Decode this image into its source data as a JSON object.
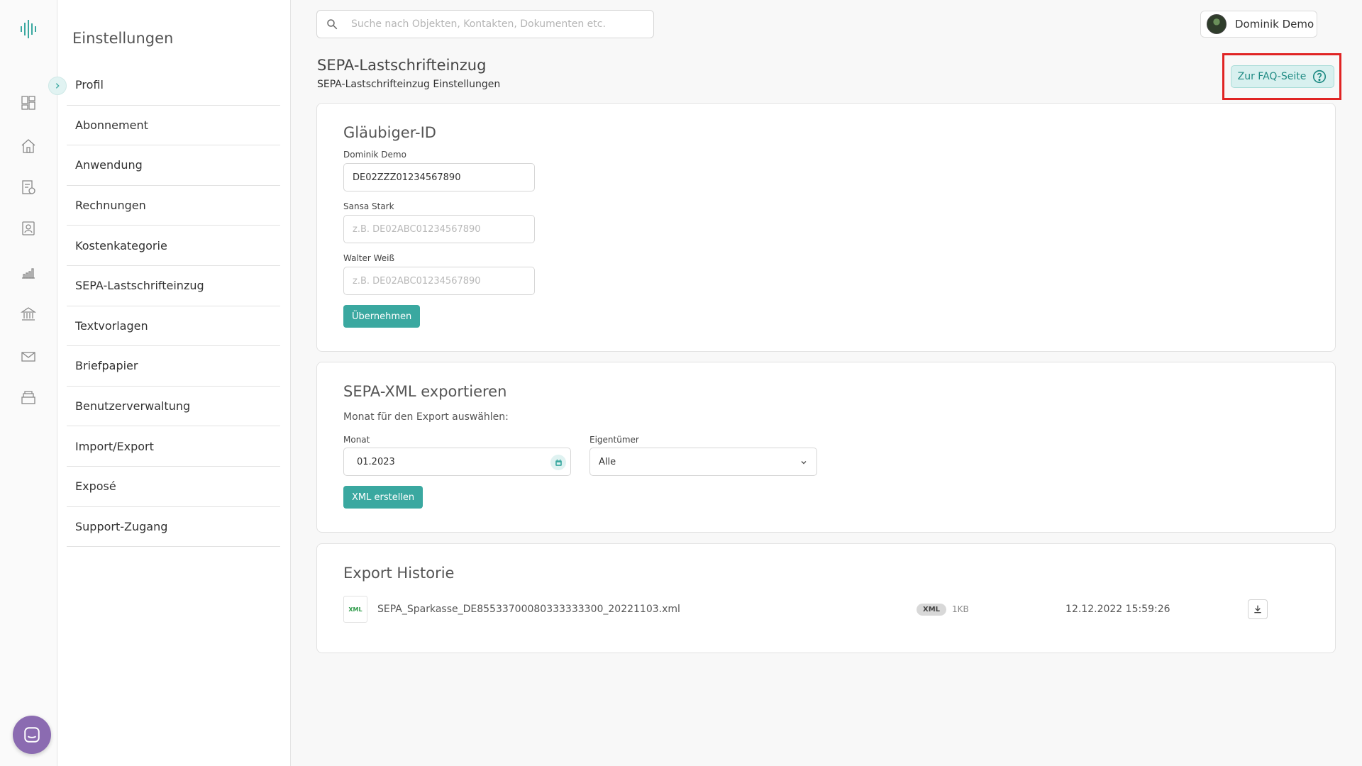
{
  "sidebar": {
    "title": "Einstellungen",
    "items": [
      {
        "label": "Profil"
      },
      {
        "label": "Abonnement"
      },
      {
        "label": "Anwendung"
      },
      {
        "label": "Rechnungen"
      },
      {
        "label": "Kostenkategorie"
      },
      {
        "label": "SEPA-Lastschrifteinzug"
      },
      {
        "label": "Textvorlagen"
      },
      {
        "label": "Briefpapier"
      },
      {
        "label": "Benutzerverwaltung"
      },
      {
        "label": "Import/Export"
      },
      {
        "label": "Exposé"
      },
      {
        "label": "Support-Zugang"
      }
    ]
  },
  "rail": {
    "icons": [
      "dashboard-icon",
      "home-icon",
      "receipt-icon",
      "contacts-icon",
      "chart-icon",
      "bank-icon",
      "mail-icon",
      "archive-icon"
    ]
  },
  "search": {
    "placeholder": "Suche nach Objekten, Kontakten, Dokumenten etc."
  },
  "user": {
    "name": "Dominik Demo"
  },
  "page": {
    "title": "SEPA-Lastschrifteinzug",
    "subtitle": "SEPA-Lastschrifteinzug Einstellungen",
    "faq_label": "Zur FAQ-Seite"
  },
  "creditor": {
    "title": "Gläubiger-ID",
    "fields": [
      {
        "label": "Dominik Demo",
        "value": "DE02ZZZ01234567890",
        "placeholder": ""
      },
      {
        "label": "Sansa Stark",
        "value": "",
        "placeholder": "z.B. DE02ABC01234567890"
      },
      {
        "label": "Walter Weiß",
        "value": "",
        "placeholder": "z.B. DE02ABC01234567890"
      }
    ],
    "apply_label": "Übernehmen"
  },
  "sepa_export": {
    "title": "SEPA-XML exportieren",
    "helper": "Monat für den Export auswählen:",
    "month_label": "Monat",
    "month_value": "01.2023",
    "owner_label": "Eigentümer",
    "owner_value": "Alle",
    "create_label": "XML erstellen"
  },
  "history": {
    "title": "Export Historie",
    "rows": [
      {
        "thumb": "XML",
        "file": "SEPA_Sparkasse_DE85533700080333333300_20221103.xml",
        "badge": "XML",
        "size": "1KB",
        "date": "12.12.2022 15:59:26"
      }
    ]
  },
  "colors": {
    "accent": "#3aa8a0",
    "highlight": "#e02424",
    "chat": "#8b6bb1"
  }
}
